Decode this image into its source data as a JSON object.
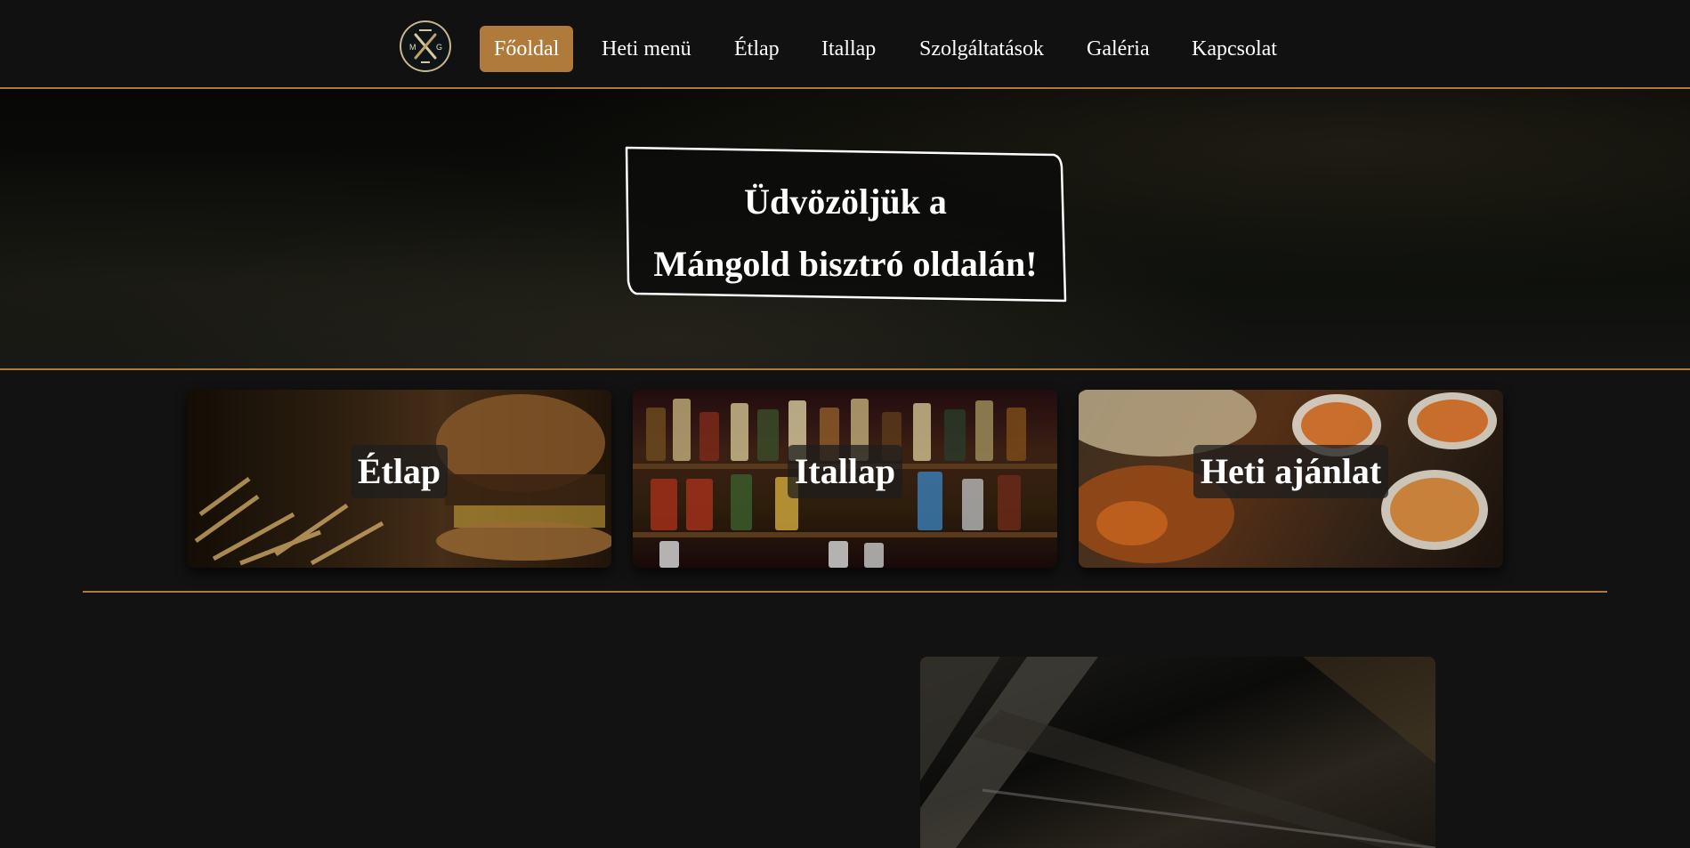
{
  "nav": {
    "logo_letters": [
      "M",
      "G"
    ],
    "items": [
      {
        "label": "Főoldal",
        "active": true
      },
      {
        "label": "Heti menü"
      },
      {
        "label": "Étlap"
      },
      {
        "label": "Itallap"
      },
      {
        "label": "Szolgáltatások"
      },
      {
        "label": "Galéria"
      },
      {
        "label": "Kapcsolat"
      }
    ]
  },
  "hero": {
    "line1": "Üdvözöljük a",
    "line2": "Mángold bisztró oldalán!"
  },
  "cards": [
    {
      "label": "Étlap"
    },
    {
      "label": "Itallap"
    },
    {
      "label": "Heti ajánlat"
    }
  ],
  "colors": {
    "accent": "#b07a3a",
    "background": "#121212",
    "navbar": "#111111"
  }
}
